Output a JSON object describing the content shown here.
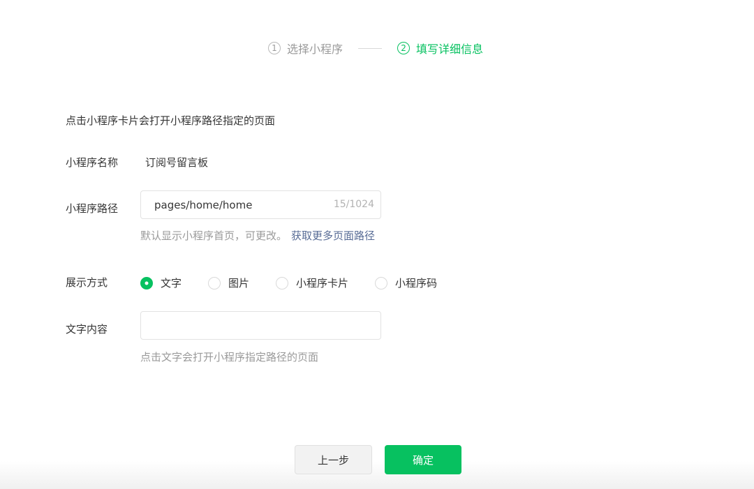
{
  "steps": [
    {
      "num": "1",
      "label": "选择小程序",
      "state": "done"
    },
    {
      "num": "2",
      "label": "填写详细信息",
      "state": "active"
    }
  ],
  "description": "点击小程序卡片会打开小程序路径指定的页面",
  "fields": {
    "name": {
      "label": "小程序名称",
      "value": "订阅号留言板"
    },
    "path": {
      "label": "小程序路径",
      "value": "pages/home/home",
      "counter": "15/1024",
      "hint": "默认显示小程序首页，可更改。",
      "hint_link": "获取更多页面路径"
    },
    "display": {
      "label": "展示方式",
      "options": [
        {
          "label": "文字",
          "checked": true
        },
        {
          "label": "图片",
          "checked": false
        },
        {
          "label": "小程序卡片",
          "checked": false
        },
        {
          "label": "小程序码",
          "checked": false
        }
      ]
    },
    "text": {
      "label": "文字内容",
      "value": "",
      "hint": "点击文字会打开小程序指定路径的页面"
    }
  },
  "buttons": {
    "prev": "上一步",
    "confirm": "确定"
  },
  "colors": {
    "accent": "#07c160",
    "link": "#576b95",
    "muted": "#9a9a9a"
  }
}
